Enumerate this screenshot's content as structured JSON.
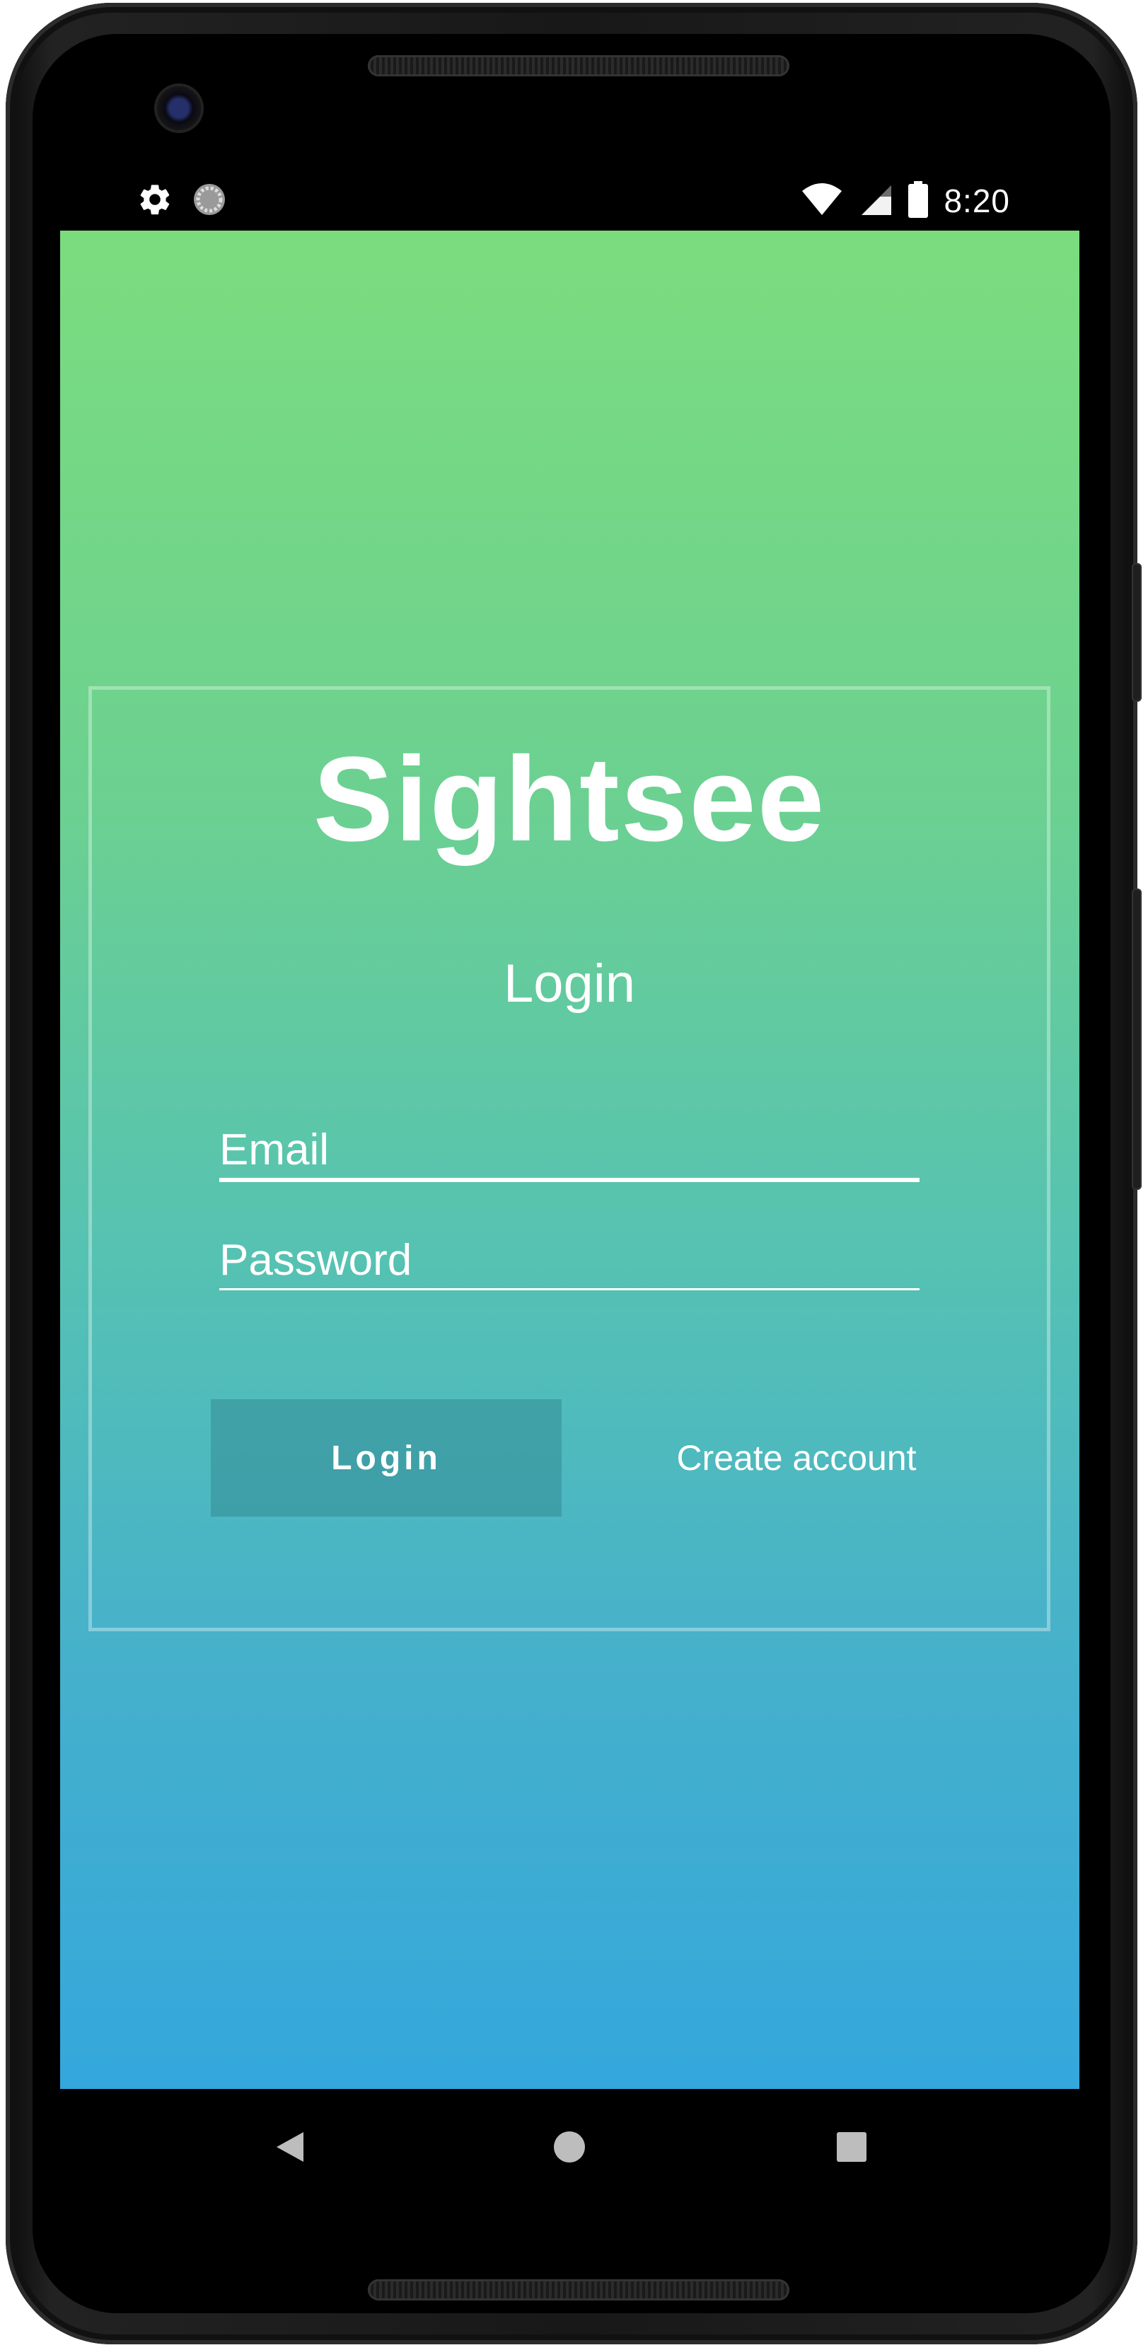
{
  "status_bar": {
    "time": "8:20",
    "left_icons": [
      "settings-icon",
      "sync-icon"
    ],
    "right_icons": [
      "wifi-icon",
      "cell-signal-icon",
      "battery-icon"
    ]
  },
  "app": {
    "brand": "Sightsee",
    "subtitle": "Login",
    "email": {
      "placeholder": "Email",
      "value": ""
    },
    "password": {
      "placeholder": "Password",
      "value": ""
    },
    "login_button": "Login",
    "create_account_link": "Create account",
    "gradient": {
      "top": "#7bdc7e",
      "bottom": "#34a7dc"
    }
  },
  "nav_bar": {
    "buttons": [
      "back-icon",
      "home-icon",
      "recents-icon"
    ]
  }
}
